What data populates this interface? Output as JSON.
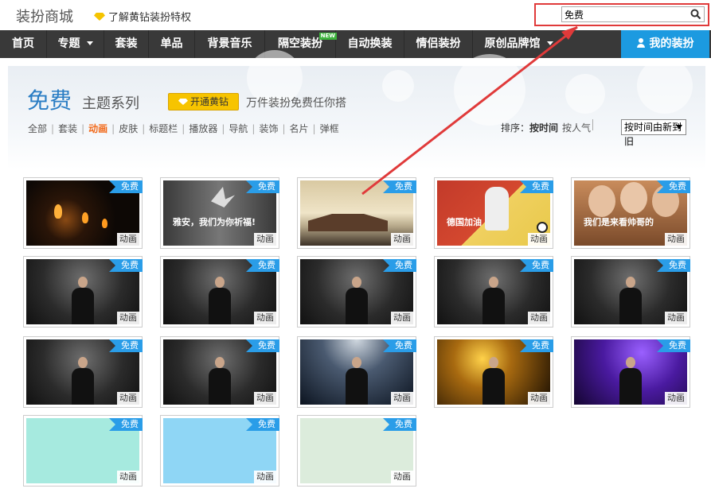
{
  "header": {
    "brand": "装扮商城",
    "vip_link": "了解黄钻装扮特权",
    "search": {
      "value": "免费",
      "placeholder": ""
    }
  },
  "nav": {
    "items": [
      {
        "label": "首页"
      },
      {
        "label": "专题",
        "dropdown": true
      },
      {
        "label": "套装"
      },
      {
        "label": "单品"
      },
      {
        "label": "背景音乐"
      },
      {
        "label": "隔空装扮",
        "badge": "NEW"
      },
      {
        "label": "自动换装"
      },
      {
        "label": "情侣装扮"
      },
      {
        "label": "原创品牌馆",
        "dropdown": true
      }
    ],
    "my_button": "我的装扮"
  },
  "hero": {
    "title": "免费",
    "subtitle": "主题系列",
    "open_vip_label": "开通黄钻",
    "slogan": "万件装扮免费任你搭",
    "categories": [
      "全部",
      "套装",
      "动画",
      "皮肤",
      "标题栏",
      "播放器",
      "导航",
      "装饰",
      "名片",
      "弹框"
    ],
    "active_category": "动画",
    "sort_label": "排序：",
    "sort_options": [
      "按时间",
      "按人气"
    ],
    "sort_select": "按时间由新到旧"
  },
  "items": [
    {
      "free": "免费",
      "tag": "动画",
      "theme": "candles"
    },
    {
      "free": "免费",
      "tag": "动画",
      "theme": "crane",
      "caption": "雅安，我们为你祈福!"
    },
    {
      "free": "免费",
      "tag": "动画",
      "theme": "snow-village"
    },
    {
      "free": "免费",
      "tag": "动画",
      "theme": "football",
      "caption": "德国加油"
    },
    {
      "free": "免费",
      "tag": "动画",
      "theme": "cheer-girls",
      "caption": "我们是来看帅哥的"
    },
    {
      "free": "免费",
      "tag": "动画",
      "theme": "singer-dark"
    },
    {
      "free": "免费",
      "tag": "动画",
      "theme": "singer-dark"
    },
    {
      "free": "免费",
      "tag": "动画",
      "theme": "singer-dark"
    },
    {
      "free": "免费",
      "tag": "动画",
      "theme": "singer-dark"
    },
    {
      "free": "免费",
      "tag": "动画",
      "theme": "singer-dark"
    },
    {
      "free": "免费",
      "tag": "动画",
      "theme": "singer-dark"
    },
    {
      "free": "免费",
      "tag": "动画",
      "theme": "singer-dark"
    },
    {
      "free": "免费",
      "tag": "动画",
      "theme": "stage-blue"
    },
    {
      "free": "免费",
      "tag": "动画",
      "theme": "stage-gold"
    },
    {
      "free": "免费",
      "tag": "动画",
      "theme": "stage-purple"
    },
    {
      "free": "免费",
      "tag": "动画",
      "theme": "mint-pattern"
    },
    {
      "free": "免费",
      "tag": "动画",
      "theme": "sky-blue"
    },
    {
      "free": "免费",
      "tag": "动画",
      "theme": "pale-green"
    }
  ],
  "colors": {
    "nav_bg": "#393939",
    "accent_blue": "#1c9ae0",
    "active_orange": "#f26a1b",
    "vip_yellow": "#f7c400",
    "annotation_red": "#e03a3a"
  }
}
